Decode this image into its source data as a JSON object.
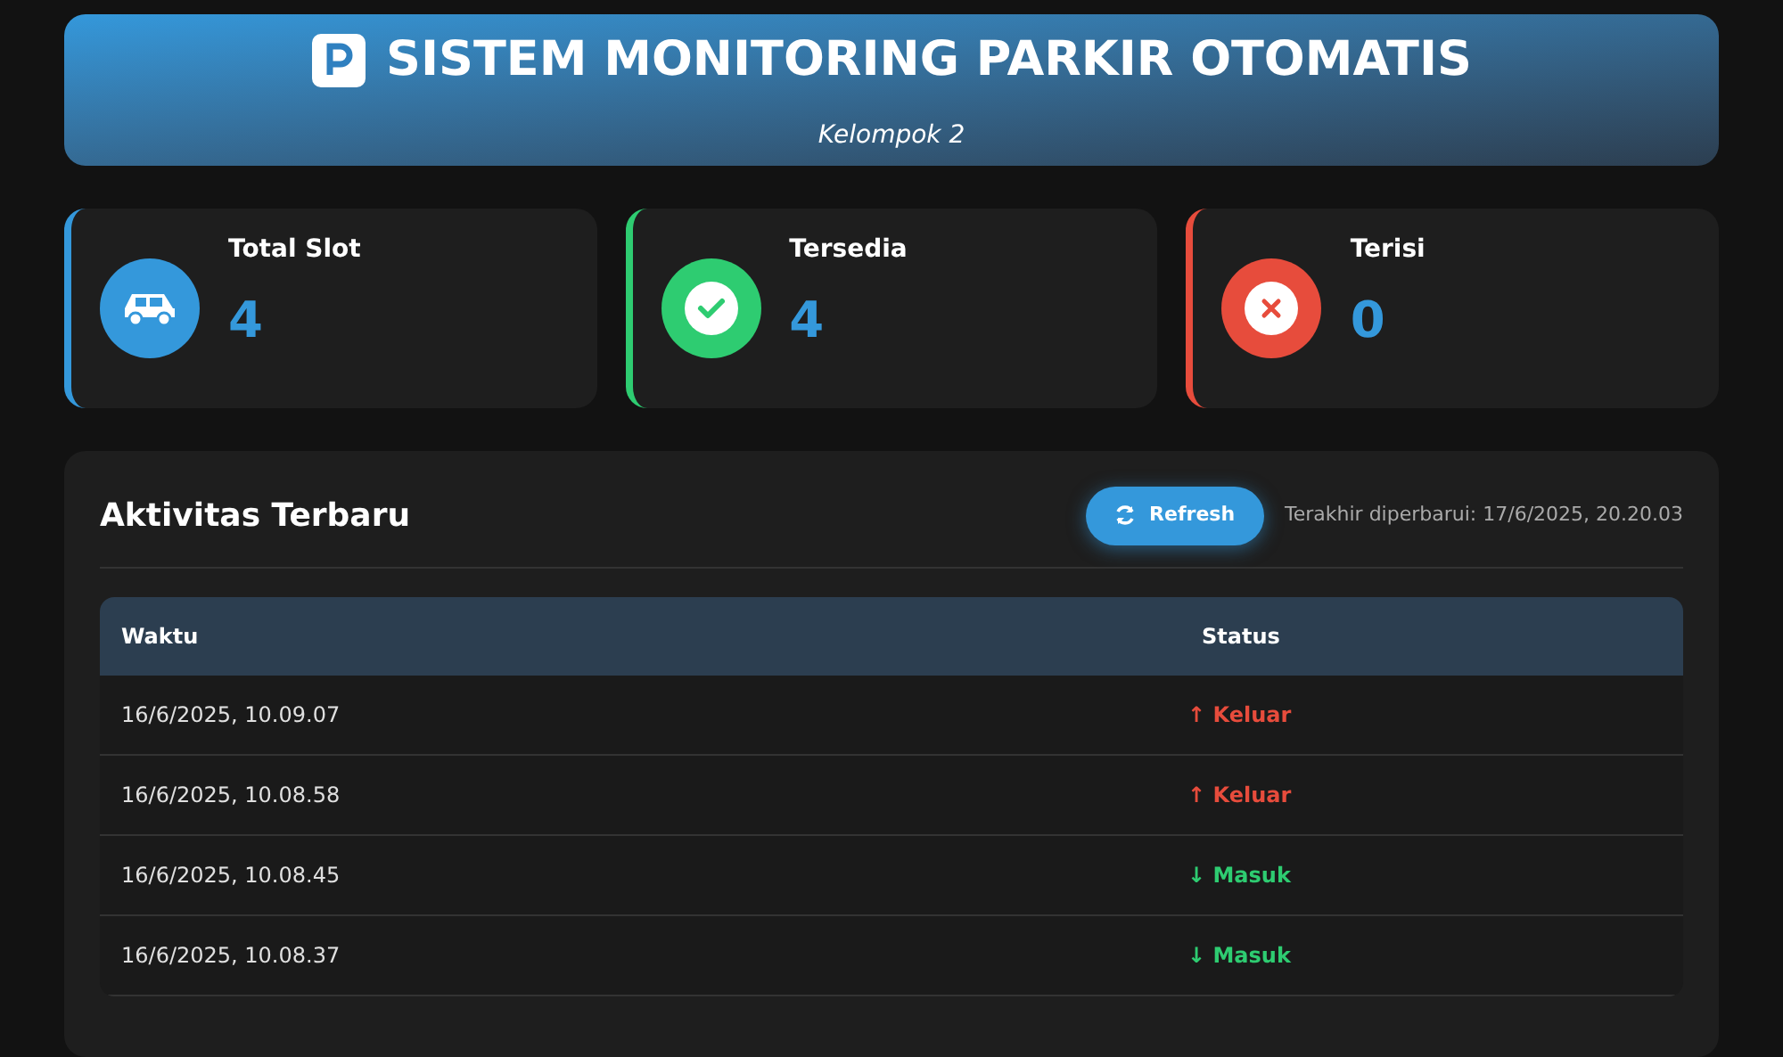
{
  "header": {
    "title": "SISTEM MONITORING PARKIR OTOMATIS",
    "subtitle": "Kelompok 2"
  },
  "cards": [
    {
      "kind": "car",
      "label": "Total Slot",
      "value": "4",
      "color": "#3498db"
    },
    {
      "kind": "check",
      "label": "Tersedia",
      "value": "4",
      "color": "#2ecc71"
    },
    {
      "kind": "cross",
      "label": "Terisi",
      "value": "0",
      "color": "#e74c3c"
    }
  ],
  "activity": {
    "title": "Aktivitas Terbaru",
    "refresh_button": "Refresh",
    "last_updated": "Terakhir diperbarui: 17/6/2025, 20.20.03",
    "table": {
      "columns": [
        "Waktu",
        "Status"
      ],
      "rows": [
        {
          "time": "16/6/2025, 10.09.07",
          "status": "↑ Keluar",
          "kind": "out"
        },
        {
          "time": "16/6/2025, 10.08.58",
          "status": "↑ Keluar",
          "kind": "out"
        },
        {
          "time": "16/6/2025, 10.08.45",
          "status": "↓ Masuk",
          "kind": "in"
        },
        {
          "time": "16/6/2025, 10.08.37",
          "status": "↓ Masuk",
          "kind": "in"
        }
      ]
    }
  }
}
